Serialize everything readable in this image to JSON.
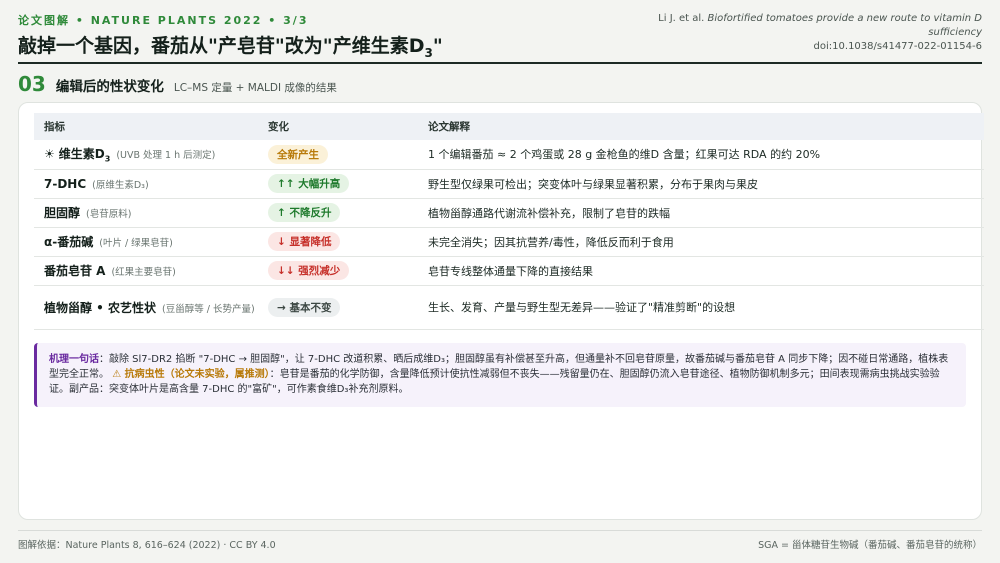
{
  "header": {
    "kicker": "论文图解 • NATURE PLANTS 2022 • 3/3",
    "title_main": "敲掉一个基因，番茄从\"产皂苷\"改为\"产维生素D",
    "title_sub": "3",
    "title_end": "\"",
    "ref_authors": "Li J. et al.",
    "ref_title": "Biofortified tomatoes provide a new route to vitamin D sufficiency",
    "ref_doi": "doi:10.1038/s41477-022-01154-6"
  },
  "section": {
    "number": "03",
    "title": "编辑后的性状变化",
    "subtitle": "LC–MS 定量 + MALDI 成像的结果"
  },
  "table": {
    "headers": [
      "指标",
      "变化",
      "论文解释"
    ],
    "rows": [
      {
        "icon": "☀",
        "name": "维生素D",
        "name_sub": "3",
        "note": "(UVB 处理 1 h 后测定)",
        "change": "全新产生",
        "tone": "yellow",
        "interp": "1 个编辑番茄 ≈ 2 个鸡蛋或 28 g 金枪鱼的维D 含量；红果可达 RDA 的约 20%"
      },
      {
        "icon": "",
        "name": "7-DHC",
        "name_sub": "",
        "note": "(原维生素D₃)",
        "change": "↑↑ 大幅升高",
        "tone": "green",
        "interp": "野生型仅绿果可检出；突变体叶与绿果显著积累，分布于果肉与果皮"
      },
      {
        "icon": "",
        "name": "胆固醇",
        "name_sub": "",
        "note": "(皂苷原料)",
        "change": "↑ 不降反升",
        "tone": "green",
        "interp": "植物甾醇通路代谢流补偿补充，限制了皂苷的跌幅"
      },
      {
        "icon": "",
        "name": "α-番茄碱",
        "name_sub": "",
        "note": "(叶片 / 绿果皂苷)",
        "change": "↓ 显著降低",
        "tone": "red",
        "interp": "未完全消失；因其抗营养/毒性，降低反而利于食用"
      },
      {
        "icon": "",
        "name": "番茄皂苷 A",
        "name_sub": "",
        "note": "(红果主要皂苷)",
        "change": "↓↓ 强烈减少",
        "tone": "red",
        "interp": "皂苷专线整体通量下降的直接结果"
      },
      {
        "icon": "",
        "name": "植物甾醇 • 农艺性状",
        "name_sub": "",
        "note": "(豆甾醇等 / 长势产量)",
        "change": "→ 基本不变",
        "tone": "grey",
        "interp": "生长、发育、产量与野生型无差异——验证了\"精准剪断\"的设想"
      }
    ]
  },
  "mechanism": {
    "lead": "机理一句话",
    "text1": "：敲除 Sl7-DR2 掐断 \"7-DHC → 胆固醇\"，让 7-DHC 改道积累、晒后成维D₃；胆固醇虽有补偿甚至升高，但通量补不回皂苷原量，故番茄碱与番茄皂苷 A 同步下降；因不碰日常通路，植株表型完全正常。",
    "warn": "⚠ 抗病虫性（论文未实验，属推测）",
    "text2": "：皂苷是番茄的化学防御，含量降低预计使抗性减弱但不丧失——残留量仍在、胆固醇仍流入皂苷途径、植物防御机制多元；田间表现需病虫挑战实验验证。副产品：突变体叶片是高含量 7-DHC 的\"富矿\"，可作素食维D₃补充剂原料。"
  },
  "footer": {
    "left": "图解依据：Nature Plants 8, 616–624 (2022) · CC BY 4.0",
    "right": "SGA = 甾体糖苷生物碱（番茄碱、番茄皂苷的统称）"
  }
}
